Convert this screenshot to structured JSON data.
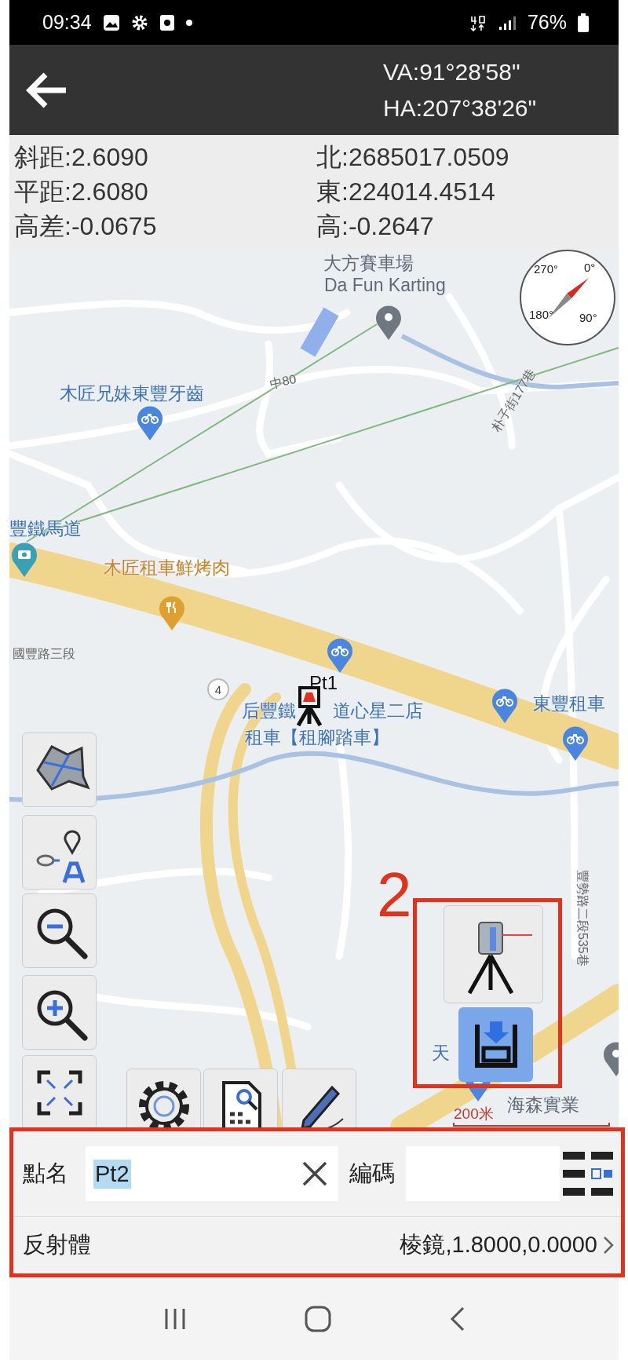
{
  "status_bar": {
    "time": "09:34",
    "battery": "76%"
  },
  "app_bar": {
    "va": "VA:91°28'58\"",
    "ha": "HA:207°38'26\""
  },
  "readings": {
    "left": [
      "斜距:2.6090",
      "平距:2.6080",
      "高差:-0.0675"
    ],
    "right": [
      "北:2685017.0509",
      "東:224014.4514",
      "高:-0.2647"
    ]
  },
  "map": {
    "labels": [
      {
        "kind": "place",
        "text": "大方賽車場"
      },
      {
        "kind": "place",
        "text": "Da Fun Karting"
      },
      {
        "kind": "road",
        "text": "中80"
      },
      {
        "kind": "poi",
        "text": "木匠兄妹東豐牙齒"
      },
      {
        "kind": "road",
        "text": "朴子街177巷"
      },
      {
        "kind": "poi",
        "text": "豐鐵馬道"
      },
      {
        "kind": "food",
        "text": "木匠租車鮮烤肉"
      },
      {
        "kind": "road",
        "text": "國豐路三段"
      },
      {
        "kind": "poi",
        "text": "后豐鐵"
      },
      {
        "kind": "poi",
        "text": "道心星二店"
      },
      {
        "kind": "poi",
        "text": "租車【租腳踏車】"
      },
      {
        "kind": "poi",
        "text": "東豐租車"
      },
      {
        "kind": "road",
        "text": "豐勢路二段535巷"
      },
      {
        "kind": "poi",
        "text": "天"
      },
      {
        "kind": "place",
        "text": "海森實業"
      }
    ],
    "shield": "4",
    "compass": [
      "270°",
      "0°",
      "180°",
      "90°"
    ],
    "point": "Pt1",
    "scale": "200米",
    "annotation": "2"
  },
  "form": {
    "name_label": "點名",
    "name_value": "Pt2",
    "name_value_selected": true,
    "code_label": "編碼",
    "reflector_label": "反射體",
    "reflector_value": "棱鏡,1.8000,0.0000"
  }
}
